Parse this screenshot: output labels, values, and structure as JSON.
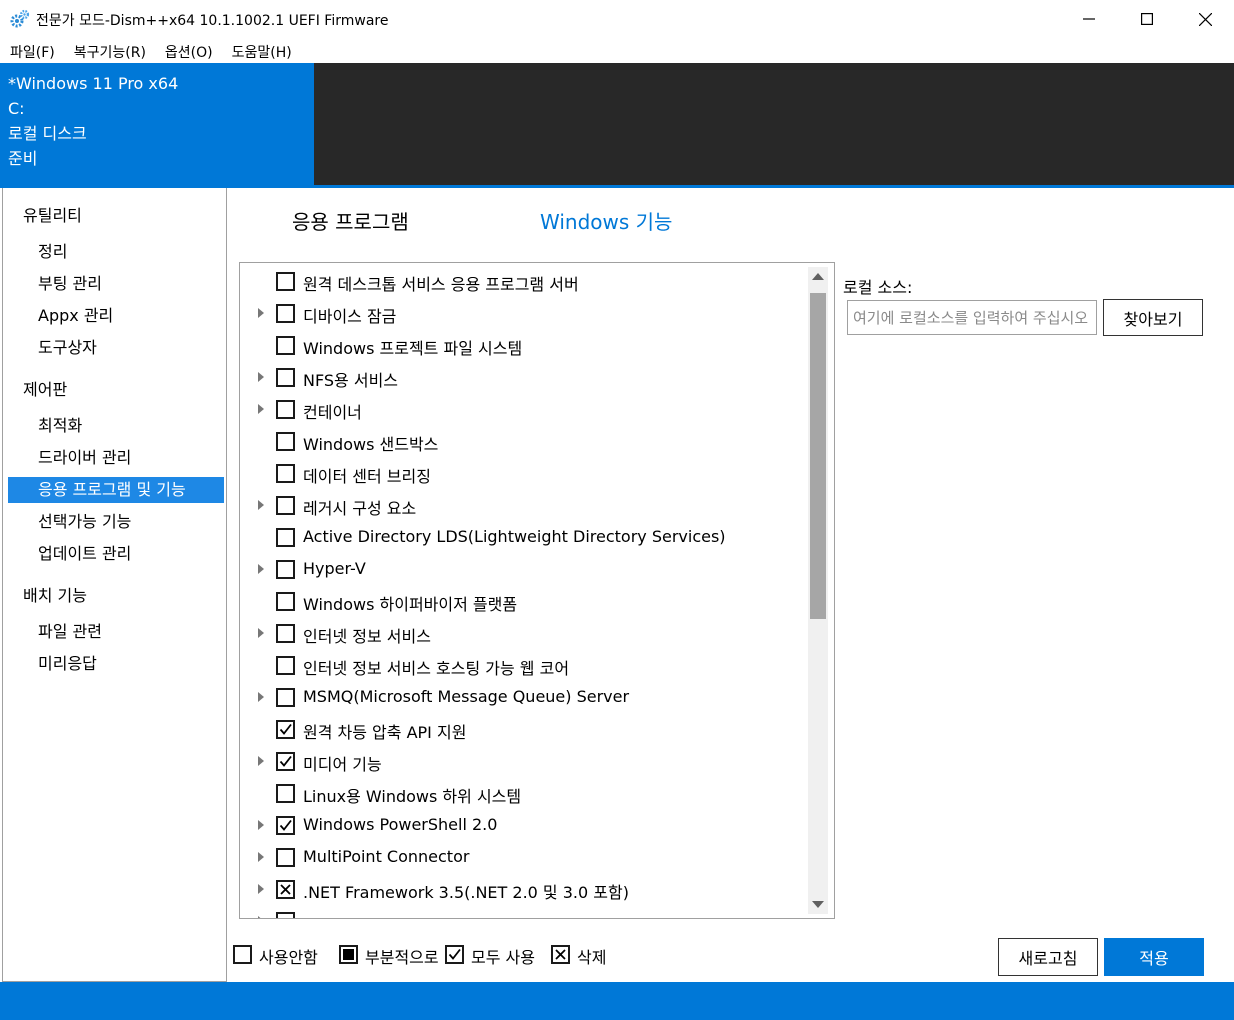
{
  "window": {
    "title": "전문가 모드-Dism++x64 10.1.1002.1 UEFI Firmware",
    "app_icon": "gears-icon",
    "minimize_icon": "minimize-icon",
    "maximize_icon": "maximize-icon",
    "close_icon": "close-icon"
  },
  "menu": [
    {
      "label": "파일(F)"
    },
    {
      "label": "복구기능(R)"
    },
    {
      "label": "옵션(O)"
    },
    {
      "label": "도움말(H)"
    }
  ],
  "header": {
    "os_name": "*Windows 11 Pro x64",
    "drive": "C:",
    "disk": "로컬 디스크",
    "status": "준비"
  },
  "sidebar": {
    "groups": [
      {
        "title": "유틸리티",
        "items": [
          {
            "label": "정리"
          },
          {
            "label": "부팅 관리"
          },
          {
            "label": "Appx 관리"
          },
          {
            "label": "도구상자"
          }
        ]
      },
      {
        "title": "제어판",
        "items": [
          {
            "label": "최적화"
          },
          {
            "label": "드라이버 관리"
          },
          {
            "label": "응용 프로그램 및 기능"
          },
          {
            "label": "선택가능 기능"
          },
          {
            "label": "업데이트 관리"
          }
        ]
      },
      {
        "title": "배치 기능",
        "items": [
          {
            "label": "파일 관련"
          },
          {
            "label": "미리응답"
          }
        ]
      }
    ],
    "active_item": "응용 프로그램 및 기능"
  },
  "tabs": {
    "apps": "응용 프로그램",
    "features": "Windows 기능",
    "active": "features"
  },
  "features": [
    {
      "label": "원격 데스크톱 서비스 응용 프로그램 서버",
      "expandable": false,
      "state": "off"
    },
    {
      "label": "디바이스 잠금",
      "expandable": true,
      "state": "off"
    },
    {
      "label": "Windows 프로젝트 파일 시스템",
      "expandable": false,
      "state": "off"
    },
    {
      "label": "NFS용 서비스",
      "expandable": true,
      "state": "off"
    },
    {
      "label": "컨테이너",
      "expandable": true,
      "state": "off"
    },
    {
      "label": "Windows 샌드박스",
      "expandable": false,
      "state": "off"
    },
    {
      "label": "데이터 센터 브리징",
      "expandable": false,
      "state": "off"
    },
    {
      "label": "레거시 구성 요소",
      "expandable": true,
      "state": "off"
    },
    {
      "label": "Active Directory LDS(Lightweight Directory Services)",
      "expandable": false,
      "state": "off"
    },
    {
      "label": "Hyper-V",
      "expandable": true,
      "state": "off"
    },
    {
      "label": "Windows 하이퍼바이저 플랫폼",
      "expandable": false,
      "state": "off"
    },
    {
      "label": "인터넷 정보 서비스",
      "expandable": true,
      "state": "off"
    },
    {
      "label": "인터넷 정보 서비스 호스팅 가능 웹 코어",
      "expandable": false,
      "state": "off"
    },
    {
      "label": "MSMQ(Microsoft Message Queue) Server",
      "expandable": true,
      "state": "off"
    },
    {
      "label": "원격 차등 압축 API 지원",
      "expandable": false,
      "state": "on"
    },
    {
      "label": "미디어 기능",
      "expandable": true,
      "state": "on"
    },
    {
      "label": "Linux용 Windows 하위 시스템",
      "expandable": false,
      "state": "off"
    },
    {
      "label": "Windows PowerShell 2.0",
      "expandable": true,
      "state": "on"
    },
    {
      "label": "MultiPoint Connector",
      "expandable": true,
      "state": "off"
    },
    {
      "label": ".NET Framework 3.5(.NET 2.0 및 3.0 포함)",
      "expandable": true,
      "state": "delete"
    }
  ],
  "local_source": {
    "label": "로컬 소스:",
    "placeholder": "여기에 로컬소스를 입력하여 주십시오",
    "value": "",
    "browse_label": "찾아보기"
  },
  "legend": [
    {
      "label": "사용안함",
      "state": "off"
    },
    {
      "label": "부분적으로",
      "state": "partial"
    },
    {
      "label": "모두 사용",
      "state": "on"
    },
    {
      "label": "삭제",
      "state": "delete"
    }
  ],
  "buttons": {
    "refresh": "새로고침",
    "apply": "적용"
  },
  "colors": {
    "accent": "#0078d7",
    "header_dark": "#282828",
    "sidebar_active": "#1e88e5"
  }
}
